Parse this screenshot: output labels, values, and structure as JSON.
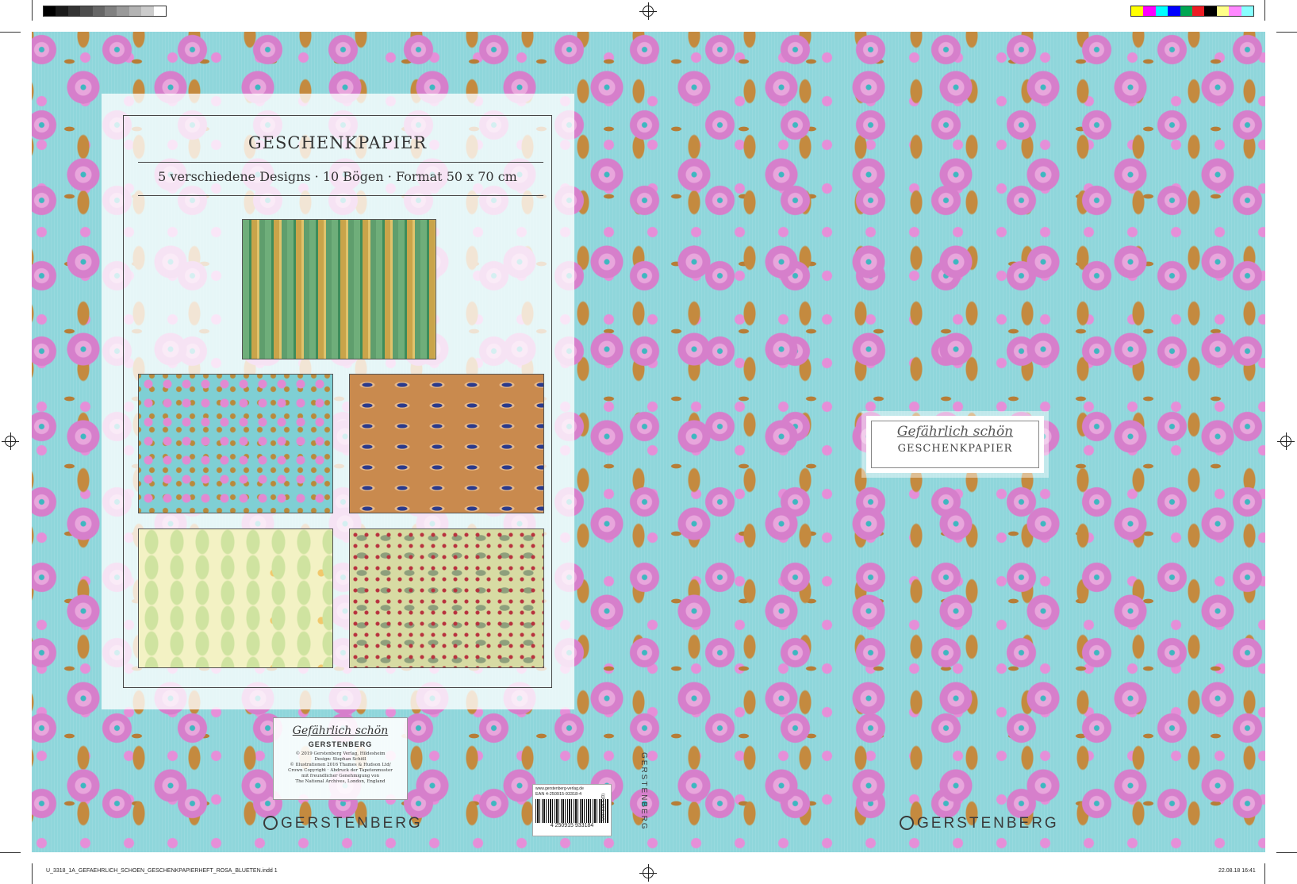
{
  "back": {
    "title": "GESCHENKPAPIER",
    "subtitle": "5 verschiedene Designs · 10 Bögen · Format 50 x 70 cm"
  },
  "imprint": {
    "script_title": "Gefährlich schön",
    "logo": "GERSTENBERG",
    "lines": [
      "© 2019 Gerstenberg Verlag, Hildesheim",
      "Design: Stephan Schöll",
      "© Illustrationen 2016 Thames & Hudson Ltd/",
      "Crown Copyright · Abdruck der Tapetenmuster",
      "mit freundlicher Genehmigung von",
      "The National Archives, London, England"
    ]
  },
  "logos": {
    "back_bottom": "GERSTENBERG",
    "spine": "GERSTENBERG",
    "front_bottom": "GERSTENBERG"
  },
  "barcode": {
    "url": "www.gerstenberg-verlag.de",
    "ean": "EAN 4-250915-93318-4",
    "digits": "4 250915 933184",
    "uvp": "UVP 9,95 € (D)"
  },
  "front": {
    "script_title": "Gefährlich schön",
    "title": "GESCHENKPAPIER"
  },
  "slug": {
    "left": "U_3318_1A_GEFAEHRLICH_SCHOEN_GESCHENKPAPIERHEFT_ROSA_BLUETEN.indd 1",
    "right": "22.08.18 16:41"
  },
  "colors": {
    "background": "#8fd6db",
    "flower_pink": "#d67fcb",
    "leaf_brown": "#b77d36"
  }
}
